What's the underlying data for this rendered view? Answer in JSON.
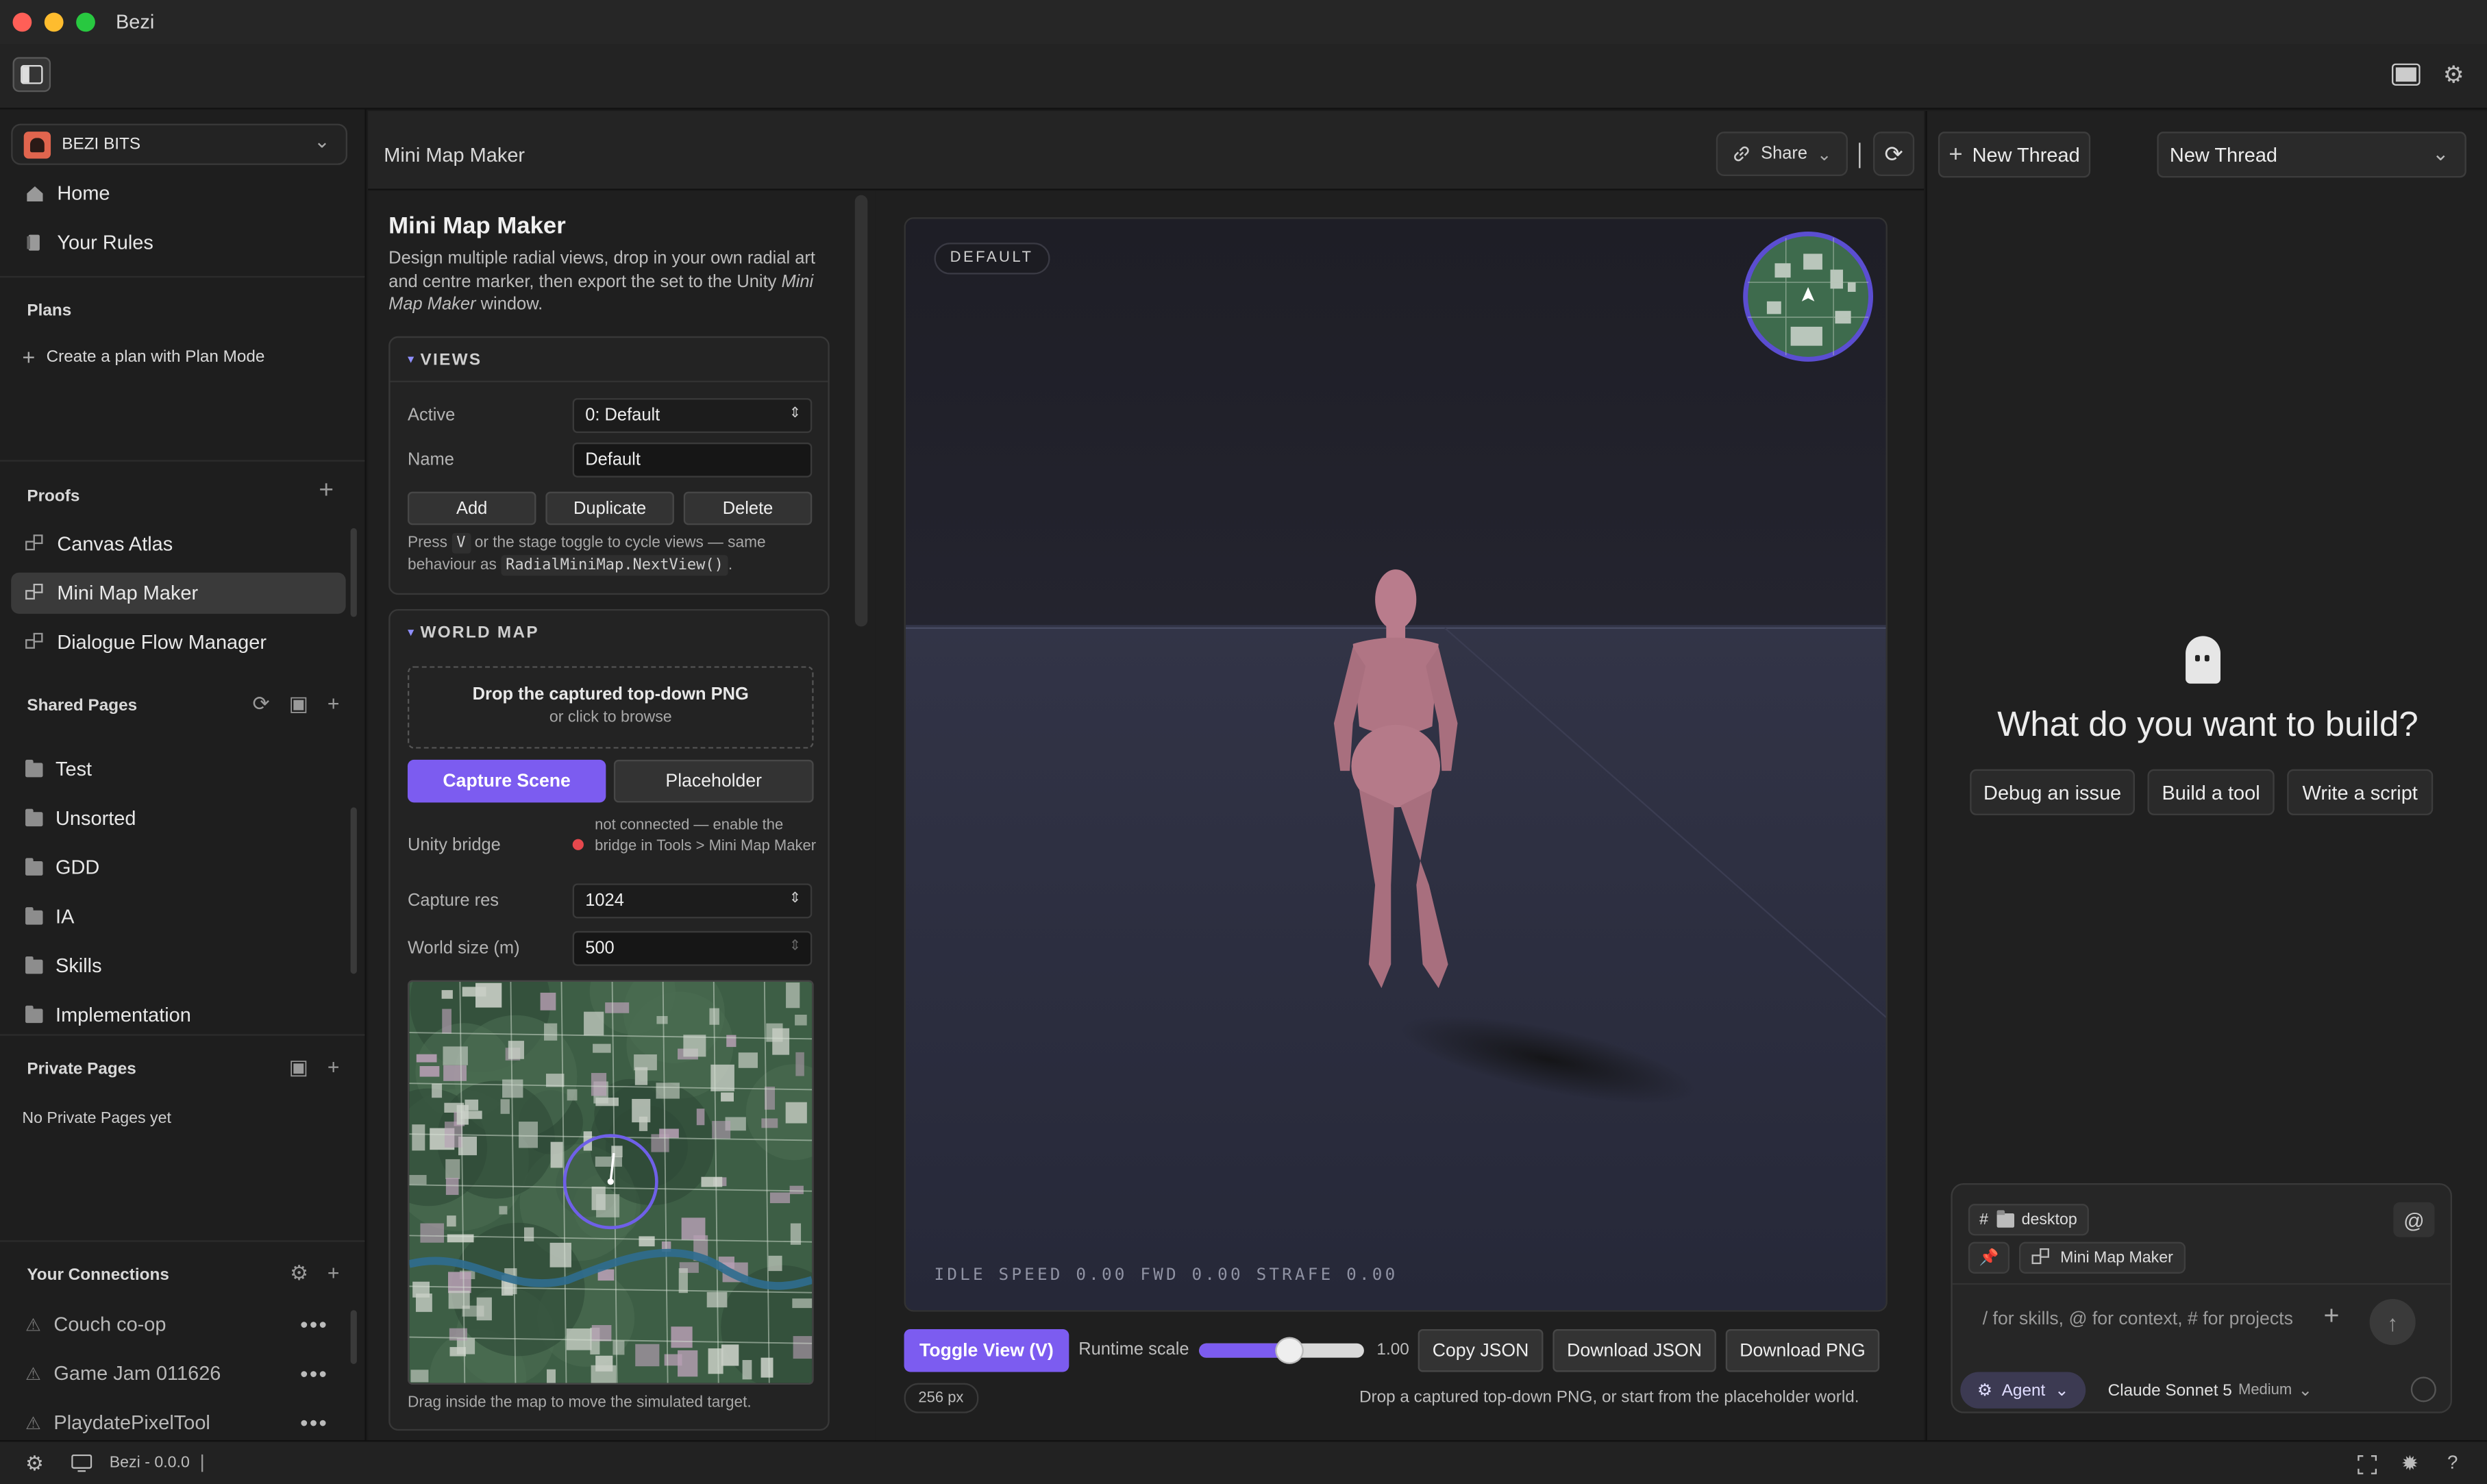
{
  "app": {
    "title": "Bezi"
  },
  "sidebar": {
    "workspace": "BEZI BITS",
    "nav": [
      {
        "label": "Home"
      },
      {
        "label": "Your Rules"
      }
    ],
    "plans": {
      "heading": "Plans",
      "create": "Create a plan with Plan Mode"
    },
    "proofs": {
      "heading": "Proofs",
      "items": [
        "Canvas Atlas",
        "Mini Map Maker",
        "Dialogue Flow Manager"
      ]
    },
    "shared": {
      "heading": "Shared Pages",
      "items": [
        "Test",
        "Unsorted",
        "GDD",
        "IA",
        "Skills",
        "Implementation"
      ]
    },
    "private": {
      "heading": "Private Pages",
      "empty": "No Private Pages yet"
    },
    "connections": {
      "heading": "Your Connections",
      "items": [
        "Couch co-op",
        "Game Jam 011626",
        "PlaydatePixelTool"
      ]
    }
  },
  "main": {
    "breadcrumb": "Mini Map Maker",
    "share_label": "Share"
  },
  "panel": {
    "title": "Mini Map Maker",
    "desc_1": "Design multiple radial views, drop in your own radial art and centre marker, then export the set to the Unity",
    "desc_em": "Mini Map Maker",
    "desc_2": "window.",
    "views": {
      "heading": "VIEWS",
      "active_label": "Active",
      "active_value": "0: Default",
      "name_label": "Name",
      "name_value": "Default",
      "add": "Add",
      "duplicate": "Duplicate",
      "delete": "Delete",
      "hint_1": "Press",
      "hint_key": "V",
      "hint_2": "or the stage toggle to cycle views — same behaviour as",
      "hint_code": "RadialMiniMap.NextView()",
      "hint_3": "."
    },
    "world": {
      "heading": "WORLD MAP",
      "drop_title": "Drop the captured top-down PNG",
      "drop_sub": "or click to browse",
      "capture": "Capture Scene",
      "placeholder": "Placeholder",
      "bridge_label": "Unity bridge",
      "bridge_status": "not connected — enable the bridge in Tools > Mini Map Maker",
      "res_label": "Capture res",
      "res_value": "1024",
      "size_label": "World size (m)",
      "size_value": "500",
      "map_hint": "Drag inside the map to move the simulated target."
    }
  },
  "stage": {
    "badge": "DEFAULT",
    "hud": "IDLE SPEED 0.00 FWD 0.00 STRAFE 0.00",
    "toggle": "Toggle View (V)",
    "runtime_label": "Runtime scale",
    "runtime_value": "1.00",
    "runtime_fraction": 0.55,
    "copy_json": "Copy JSON",
    "download_json": "Download JSON",
    "download_png": "Download PNG",
    "px_badge": "256 px",
    "footer": "Drop a captured top-down PNG, or start from the placeholder world."
  },
  "right": {
    "new_thread_btn": "New Thread",
    "thread_select": "New Thread",
    "prompt": "What do you want to build?",
    "suggestions": [
      "Debug an issue",
      "Build a tool",
      "Write a script"
    ],
    "context_hash": "#",
    "context_folder": "desktop",
    "context_page": "Mini Map Maker",
    "at": "@",
    "input_placeholder": "/ for skills, @ for context, # for projects",
    "mode": "Agent",
    "model": "Claude Sonnet 5",
    "model_effort": "Medium"
  },
  "status": {
    "version": "Bezi - 0.0.0"
  },
  "colors": {
    "accent": "#7c5cf0",
    "red_dot": "#e5484d"
  }
}
